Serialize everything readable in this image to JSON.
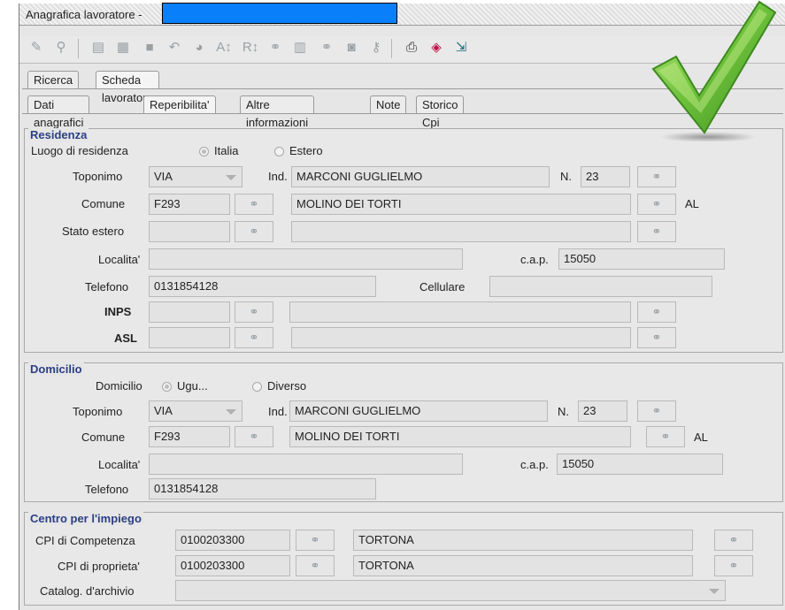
{
  "window": {
    "title": "Anagrafica lavoratore -"
  },
  "toolbar": {
    "icons": [
      "edit-icon",
      "search-icon",
      "new-document-icon",
      "new-record-icon",
      "save-icon",
      "undo-icon",
      "delete-icon",
      "sort-icon",
      "filter-icon",
      "link-icon",
      "list-icon",
      "group-icon",
      "camera-icon",
      "key-icon",
      "print-icon",
      "book-icon",
      "exit-icon"
    ]
  },
  "tabs_main": [
    "Ricerca",
    "Scheda lavoratore"
  ],
  "tabs_sub": [
    "Dati anagrafici",
    "Reperibilita'",
    "Altre informazioni",
    "Note",
    "Storico Cpi"
  ],
  "residenza": {
    "legend": "Residenza",
    "luogo_label": "Luogo di residenza",
    "opt_italia": "Italia",
    "opt_estero": "Estero",
    "toponimo_label": "Toponimo",
    "toponimo": "VIA",
    "ind_label": "Ind.",
    "indirizzo": "MARCONI GUGLIELMO",
    "n_label": "N.",
    "numero": "23",
    "comune_label": "Comune",
    "comune_code": "F293",
    "comune_name": "MOLINO DEI TORTI",
    "provincia": "AL",
    "stato_label": "Stato estero",
    "localita_label": "Localita'",
    "cap_label": "c.a.p.",
    "cap": "15050",
    "telefono_label": "Telefono",
    "telefono": "0131854128",
    "cellulare_label": "Cellulare",
    "inps_label": "INPS",
    "asl_label": "ASL"
  },
  "domicilio": {
    "legend": "Domicilio",
    "domicilio_label": "Domicilio",
    "opt_uguale": "Ugu...",
    "opt_diverso": "Diverso",
    "toponimo_label": "Toponimo",
    "toponimo": "VIA",
    "ind_label": "Ind.",
    "indirizzo": "MARCONI GUGLIELMO",
    "n_label": "N.",
    "numero": "23",
    "comune_label": "Comune",
    "comune_code": "F293",
    "comune_name": "MOLINO DEI TORTI",
    "provincia": "AL",
    "localita_label": "Localita'",
    "cap_label": "c.a.p.",
    "cap": "15050",
    "telefono_label": "Telefono",
    "telefono": "0131854128"
  },
  "cpi": {
    "legend": "Centro per l'impiego",
    "competenza_label": "CPI di Competenza",
    "competenza_code": "0100203300",
    "competenza_name": "TORTONA",
    "proprieta_label": "CPI di proprieta'",
    "proprieta_code": "0100203300",
    "proprieta_name": "TORTONA",
    "catalog_label": "Catalog. d'archivio"
  },
  "colors": {
    "legend": "#2b3f85",
    "check": "#5fb82e",
    "redact": "#0a7ffa"
  }
}
